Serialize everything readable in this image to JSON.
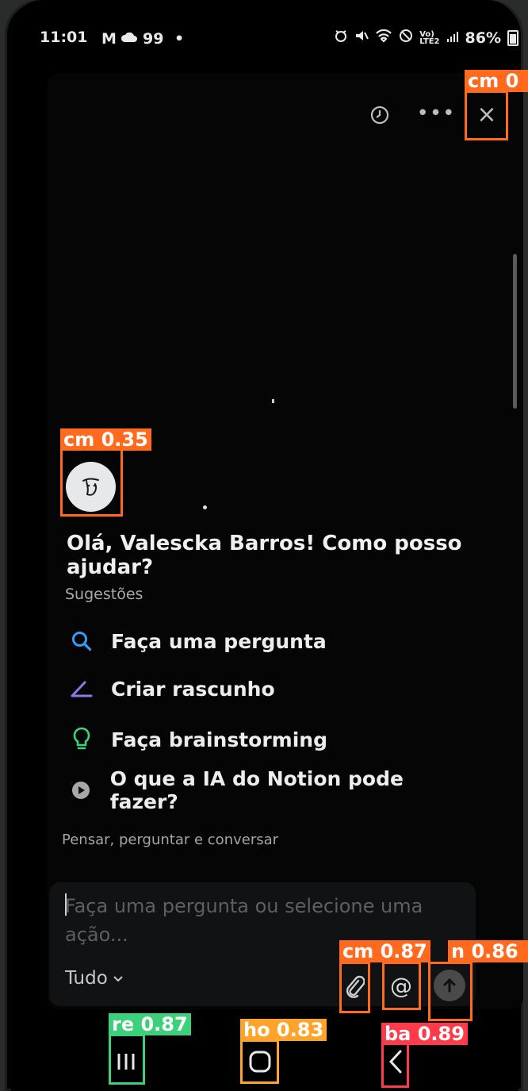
{
  "status_bar": {
    "time": "11:01",
    "mail_icon": "M",
    "notif_count": "99",
    "dot": "•",
    "battery": "86%"
  },
  "header": {
    "history_icon": "clock-icon",
    "more_label": "•••",
    "close_label": "×"
  },
  "greeting": "Olá, Valescka Barros! Como posso ajudar?",
  "suggestions": {
    "title": "Sugestões",
    "items": [
      {
        "label": "Faça uma pergunta",
        "icon": "search-icon",
        "color": "#3b9af6"
      },
      {
        "label": "Criar rascunho",
        "icon": "pen-icon",
        "color": "#8a79e6"
      },
      {
        "label": "Faça brainstorming",
        "icon": "lightbulb-icon",
        "color": "#3fd27c"
      },
      {
        "label": "O que a IA do Notion pode fazer?",
        "icon": "play-icon",
        "color": "#a8a8a8"
      }
    ]
  },
  "section_label": "Pensar, perguntar e conversar",
  "composer": {
    "placeholder": "Faça uma pergunta ou selecione uma ação...",
    "scope_label": "Tudo",
    "mention_label": "@"
  },
  "detections": [
    {
      "label": "cm 0"
    },
    {
      "label": "cm 0.35"
    },
    {
      "label": "cm 0.87"
    },
    {
      "label": "n 0.86"
    },
    {
      "label": "re 0.87"
    },
    {
      "label": "ho 0.83"
    },
    {
      "label": "ba 0.89"
    }
  ]
}
